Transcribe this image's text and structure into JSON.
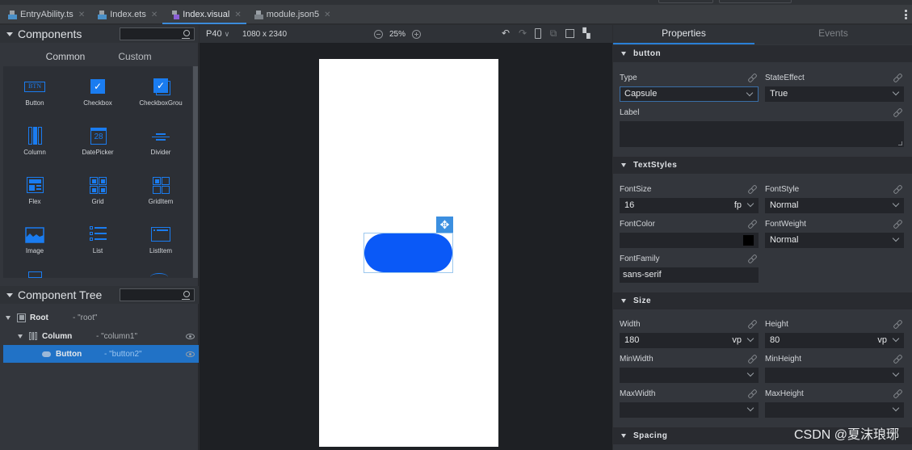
{
  "tabs": [
    {
      "label": "EntryAbility.ts",
      "icon": "ets-file-icon",
      "active": false
    },
    {
      "label": "Index.ets",
      "icon": "ets-file-icon",
      "active": false
    },
    {
      "label": "Index.visual",
      "icon": "visual-file-icon",
      "active": true
    },
    {
      "label": "module.json5",
      "icon": "json-file-icon",
      "active": false
    }
  ],
  "components_panel": {
    "title": "Components",
    "search_placeholder": "",
    "subtabs": [
      "Common",
      "Custom"
    ],
    "active_subtab": "Common",
    "items": [
      {
        "label": "Button",
        "icon": "button-icon"
      },
      {
        "label": "Checkbox",
        "icon": "checkbox-icon"
      },
      {
        "label": "CheckboxGrou",
        "icon": "checkbox-group-icon"
      },
      {
        "label": "Column",
        "icon": "column-icon"
      },
      {
        "label": "DatePicker",
        "icon": "datepicker-icon"
      },
      {
        "label": "Divider",
        "icon": "divider-icon"
      },
      {
        "label": "Flex",
        "icon": "flex-icon"
      },
      {
        "label": "Grid",
        "icon": "grid-icon"
      },
      {
        "label": "GridItem",
        "icon": "griditem-icon"
      },
      {
        "label": "Image",
        "icon": "image-icon"
      },
      {
        "label": "List",
        "icon": "list-icon"
      },
      {
        "label": "ListItem",
        "icon": "listitem-icon"
      }
    ],
    "datepicker_day": "28",
    "button_glyph": "BTN"
  },
  "component_tree": {
    "title": "Component Tree",
    "nodes": [
      {
        "name": "Root",
        "id": "- \"root\"",
        "selected": false
      },
      {
        "name": "Column",
        "id": "- \"column1\"",
        "selected": false
      },
      {
        "name": "Button",
        "id": "- \"button2\"",
        "selected": true
      }
    ]
  },
  "canvas": {
    "device": "P40",
    "resolution": "1080 x 2340",
    "zoom": "25%",
    "button_color": "#0a59f7"
  },
  "properties": {
    "tabs": [
      "Properties",
      "Events"
    ],
    "active_tab": "Properties",
    "sections": {
      "button": "button",
      "text_styles": "TextStyles",
      "size": "Size",
      "spacing": "Spacing"
    },
    "button": {
      "type": {
        "label": "Type",
        "value": "Capsule"
      },
      "state_effect": {
        "label": "StateEffect",
        "value": "True"
      },
      "label": {
        "label": "Label",
        "value": ""
      }
    },
    "text_styles": {
      "font_size": {
        "label": "FontSize",
        "value": "16",
        "unit": "fp"
      },
      "font_style": {
        "label": "FontStyle",
        "value": "Normal"
      },
      "font_color": {
        "label": "FontColor",
        "value": "#000000"
      },
      "font_weight": {
        "label": "FontWeight",
        "value": "Normal"
      },
      "font_family": {
        "label": "FontFamily",
        "value": "sans-serif"
      }
    },
    "size": {
      "width": {
        "label": "Width",
        "value": "180",
        "unit": "vp"
      },
      "height": {
        "label": "Height",
        "value": "80",
        "unit": "vp"
      },
      "min_width": {
        "label": "MinWidth",
        "value": ""
      },
      "min_height": {
        "label": "MinHeight",
        "value": ""
      },
      "max_width": {
        "label": "MaxWidth",
        "value": ""
      },
      "max_height": {
        "label": "MaxHeight",
        "value": ""
      }
    }
  },
  "watermark": "CSDN @夏沫琅琊"
}
